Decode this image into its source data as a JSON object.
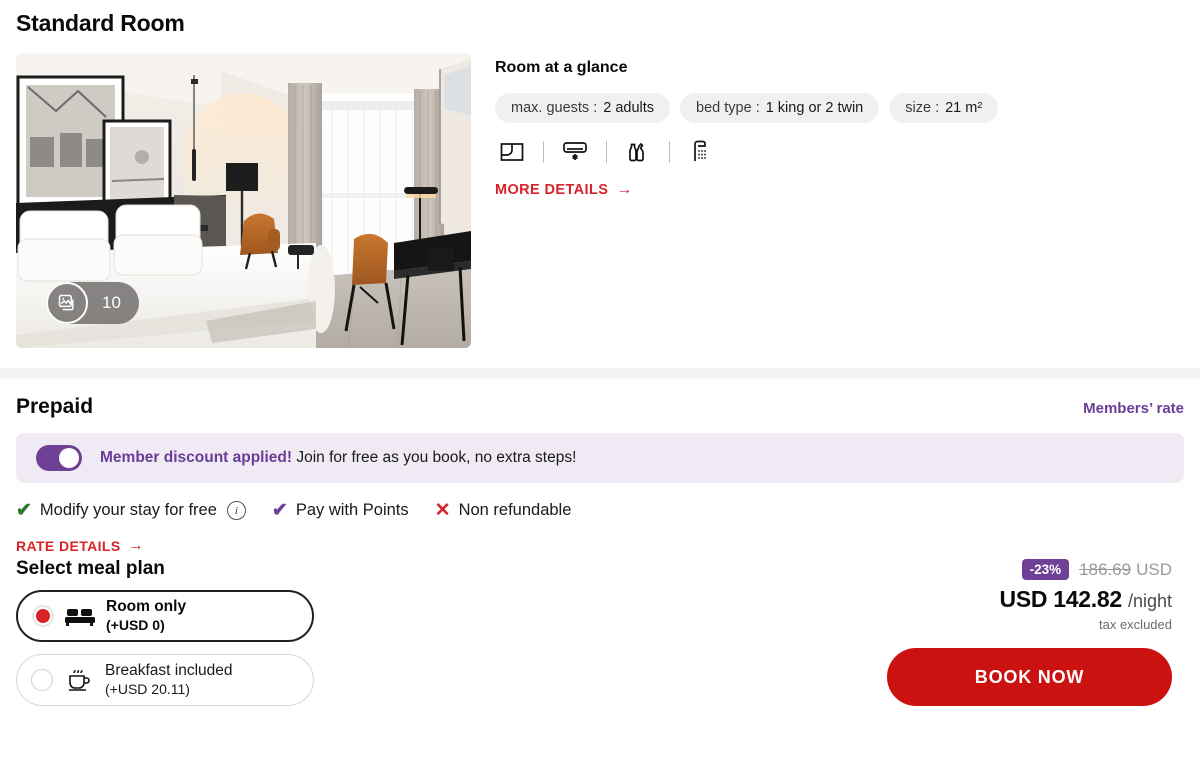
{
  "room": {
    "title": "Standard Room",
    "gallery": {
      "count": "10",
      "icon": "photo-stack-icon"
    }
  },
  "glance": {
    "title": "Room at a glance",
    "pills": [
      {
        "label": "max. guests :",
        "value": "2 adults"
      },
      {
        "label": "bed type :",
        "value": "1 king or 2 twin"
      },
      {
        "label": "size :",
        "value": "21 m²"
      }
    ],
    "amenities": [
      {
        "icon": "floor-plan-icon",
        "name": "floor plan"
      },
      {
        "icon": "air-conditioning-icon",
        "name": "air conditioning"
      },
      {
        "icon": "toiletries-icon",
        "name": "toiletries"
      },
      {
        "icon": "shower-icon",
        "name": "shower"
      }
    ],
    "more_details": "MORE DETAILS",
    "more_details_arrow": "→"
  },
  "rate": {
    "title": "Prepaid",
    "members_rate": "Members’ rate",
    "banner": {
      "strong": "Member discount applied!",
      "text": " Join for free as you book, no extra steps!",
      "toggle_on": true
    },
    "benefits": [
      {
        "glyph": "✔",
        "style": "green",
        "label": "Modify your stay for free",
        "info": "i"
      },
      {
        "glyph": "✔",
        "style": "purple",
        "label": "Pay with Points"
      },
      {
        "glyph": "✕",
        "style": "red",
        "label": "Non refundable"
      }
    ],
    "rate_details": "RATE DETAILS",
    "rate_details_arrow": "→",
    "meal_plan": {
      "title": "Select meal plan",
      "options": [
        {
          "name": "Room only",
          "sub": "(+USD 0)",
          "icon": "bed-icon",
          "selected": true
        },
        {
          "name": "Breakfast included",
          "sub": "(+USD 20.11)",
          "icon": "coffee-cup-icon",
          "selected": false
        }
      ]
    },
    "price": {
      "discount_badge": "-23%",
      "old_price": "186.69",
      "old_currency": "USD",
      "amount": "USD 142.82",
      "per": "/night",
      "tax_note": "tax excluded",
      "book_label": "BOOK NOW"
    }
  },
  "colors": {
    "brand_red": "#cc1111",
    "link_red": "#d8232a",
    "member_purple": "#6f4196",
    "banner_bg": "#efeaf4",
    "pill_bg": "#f0f0f0"
  }
}
